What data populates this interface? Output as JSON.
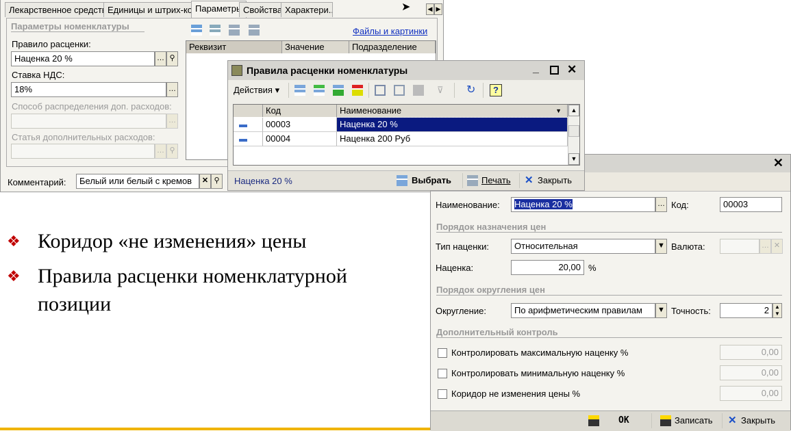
{
  "params_window": {
    "tabs": [
      "Лекарственное средство",
      "Единицы и штрих-коды",
      "Параметры",
      "Свойства",
      "Характери..."
    ],
    "active_tab": "Параметры",
    "section_title": "Параметры номенклатуры",
    "price_rule_label": "Правило расценки:",
    "price_rule_value": "Наценка 20 %",
    "vat_label": "Ставка НДС:",
    "vat_value": "18%",
    "distribution_label": "Способ распределения доп. расходов:",
    "extra_costs_label": "Статья дополнительных расходов:",
    "files_link": "Файлы и картинки",
    "table_headers": [
      "Реквизит",
      "Значение",
      "Подразделение"
    ],
    "comment_label": "Комментарий:",
    "comment_value": "Белый или белый с кремов"
  },
  "rules_dialog": {
    "title": "Правила расценки номенклатуры",
    "actions_label": "Действия",
    "columns": [
      "Код",
      "Наименование"
    ],
    "rows": [
      {
        "code": "00003",
        "name": "Наценка 20 %",
        "selected": true
      },
      {
        "code": "00004",
        "name": "Наценка 200 Руб",
        "selected": false
      }
    ],
    "status": "Наценка 20 %",
    "select_label": "Выбрать",
    "print_label": "Печать",
    "close_label": "Закрыть"
  },
  "rule_form": {
    "name_label": "Наименование:",
    "name_value": "Наценка 20 %",
    "code_label": "Код:",
    "code_value": "00003",
    "section_pricing": "Порядок назначения цен",
    "markup_type_label": "Тип наценки:",
    "markup_type_value": "Относительная",
    "currency_label": "Валюта:",
    "markup_label": "Наценка:",
    "markup_value": "20,00",
    "percent": "%",
    "section_rounding": "Порядок округления цен",
    "rounding_label": "Округление:",
    "rounding_value": "По арифметическим правилам",
    "precision_label": "Точность:",
    "precision_value": "2",
    "section_control": "Дополнительный контроль",
    "checks": [
      {
        "label": "Контролировать максимальную наценку %",
        "value": "0,00",
        "checked": false
      },
      {
        "label": "Контролировать минимальную наценку %",
        "value": "0,00",
        "checked": false
      },
      {
        "label": "Коридор не изменения цены  %",
        "value": "0,00",
        "checked": false
      }
    ],
    "ok_label": "OK",
    "save_label": "Записать",
    "close_label": "Закрыть"
  },
  "bullets": [
    "Коридор «не изменения» цены",
    "Правила расценки номенклатурной",
    "позиции"
  ]
}
